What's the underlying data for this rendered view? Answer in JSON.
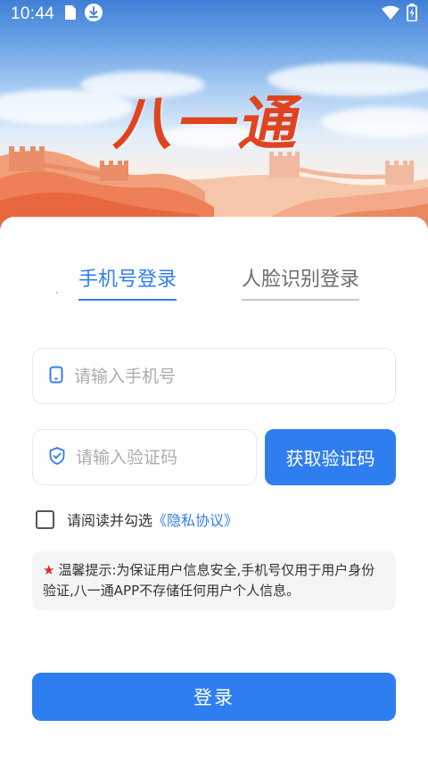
{
  "status_bar": {
    "time": "10:44"
  },
  "hero": {
    "logo_text": "八一通"
  },
  "tabs": [
    {
      "label": "手机号登录",
      "active": true
    },
    {
      "label": "人脸识别登录",
      "active": false
    }
  ],
  "form": {
    "phone_placeholder": "请输入手机号",
    "code_placeholder": "请输入验证码",
    "get_code_label": "获取验证码",
    "agree_prefix": "请阅读并勾选",
    "privacy_link": "《隐私协议》",
    "agree_checked": false
  },
  "notice": {
    "star": "★",
    "text": "温馨提示:为保证用户信息安全,手机号仅用于用户身份验证,八一通APP不存储任何用户个人信息。"
  },
  "login_button_label": "登录",
  "colors": {
    "accent": "#2f7ef0",
    "warning_star": "#e02828",
    "logo_red": "#e0441f"
  },
  "icons": {
    "phone_field": "phone-icon",
    "code_field": "shield-check-icon",
    "status": [
      "sim-card-icon",
      "download-icon",
      "wifi-icon",
      "battery-charging-icon"
    ]
  }
}
